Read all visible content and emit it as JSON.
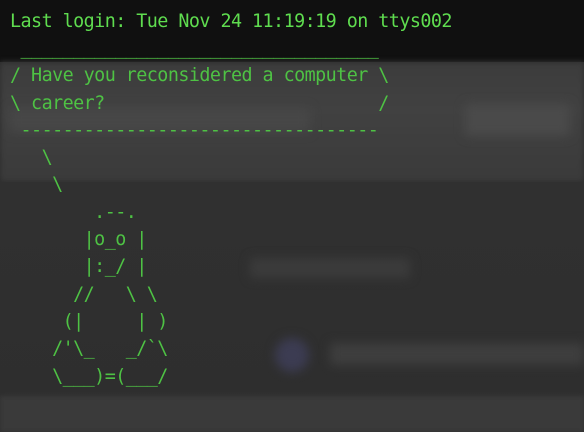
{
  "terminal": {
    "login_line": "Last login: Tue Nov 24 11:19:19 on ttys002",
    "cow_output": " __________________________________\n/ Have you reconsidered a computer \\\n\\ career?                          /\n ----------------------------------\n   \\\n    \\\n        .--.\n       |o_o |\n       |:_/ |\n      //   \\ \\\n     (|     | )\n    /'\\_   _/`\\\n    \\___)=(___/"
  },
  "colors": {
    "terminal_text": "#5fdd4f",
    "background": "#2b2b2b"
  }
}
